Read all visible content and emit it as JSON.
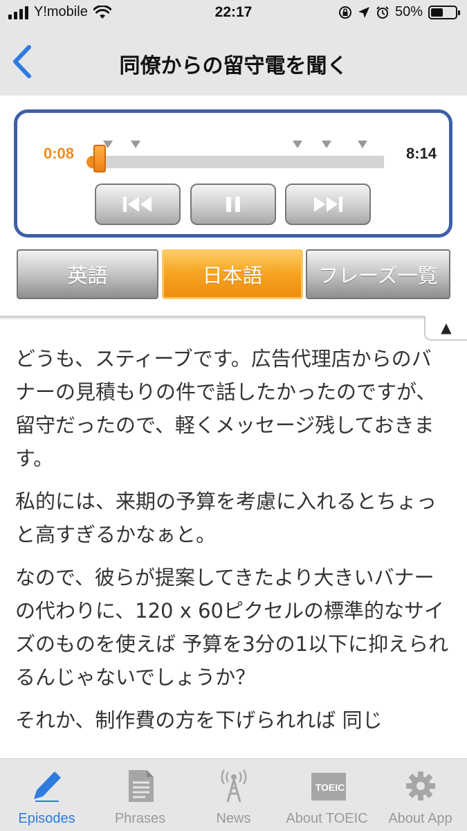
{
  "status_bar": {
    "carrier": "Y!mobile",
    "time": "22:17",
    "battery": "50%",
    "battery_level": 0.5
  },
  "nav": {
    "title": "同僚からの留守電を聞く",
    "back_icon": "chevron-left-icon"
  },
  "player": {
    "current_time": "0:08",
    "total_time": "8:14",
    "progress": 0.016,
    "accent_color": "#ef8c20",
    "frame_color": "#3f5fa8",
    "controls": [
      "skip-back-icon",
      "pause-icon",
      "skip-forward-icon"
    ]
  },
  "tabs": [
    {
      "label": "英語",
      "active": false
    },
    {
      "label": "日本語",
      "active": true
    },
    {
      "label": "フレーズ一覧",
      "active": false
    }
  ],
  "collapse_glyph": "▲",
  "transcript": [
    "どうも、スティーブです。広告代理店からのバナーの見積もりの件で話したかったのですが、留守だったので、軽くメッセージ残しておきます。",
    "私的には、来期の予算を考慮に入れるとちょっと高すぎるかなぁと。",
    "なので、彼らが提案してきたより大きいバナーの代わりに、120 x 60ピクセルの標準的なサイズのものを使えば 予算を3分の1以下に抑えられるんじゃないでしょうか？",
    "それか、制作費の方を下げられれば 同じ"
  ],
  "tab_bar": {
    "items": [
      {
        "label": "Episodes",
        "icon": "pencil-icon",
        "active": true
      },
      {
        "label": "Phrases",
        "icon": "document-icon",
        "active": false
      },
      {
        "label": "News",
        "icon": "broadcast-tower-icon",
        "active": false
      },
      {
        "label": "About TOEIC",
        "icon": "toeic-icon",
        "icon_text": "TOEIC",
        "active": false
      },
      {
        "label": "About App",
        "icon": "gear-icon",
        "active": false
      }
    ],
    "active_color": "#2f7be0",
    "inactive_color": "#9a9a9a"
  }
}
